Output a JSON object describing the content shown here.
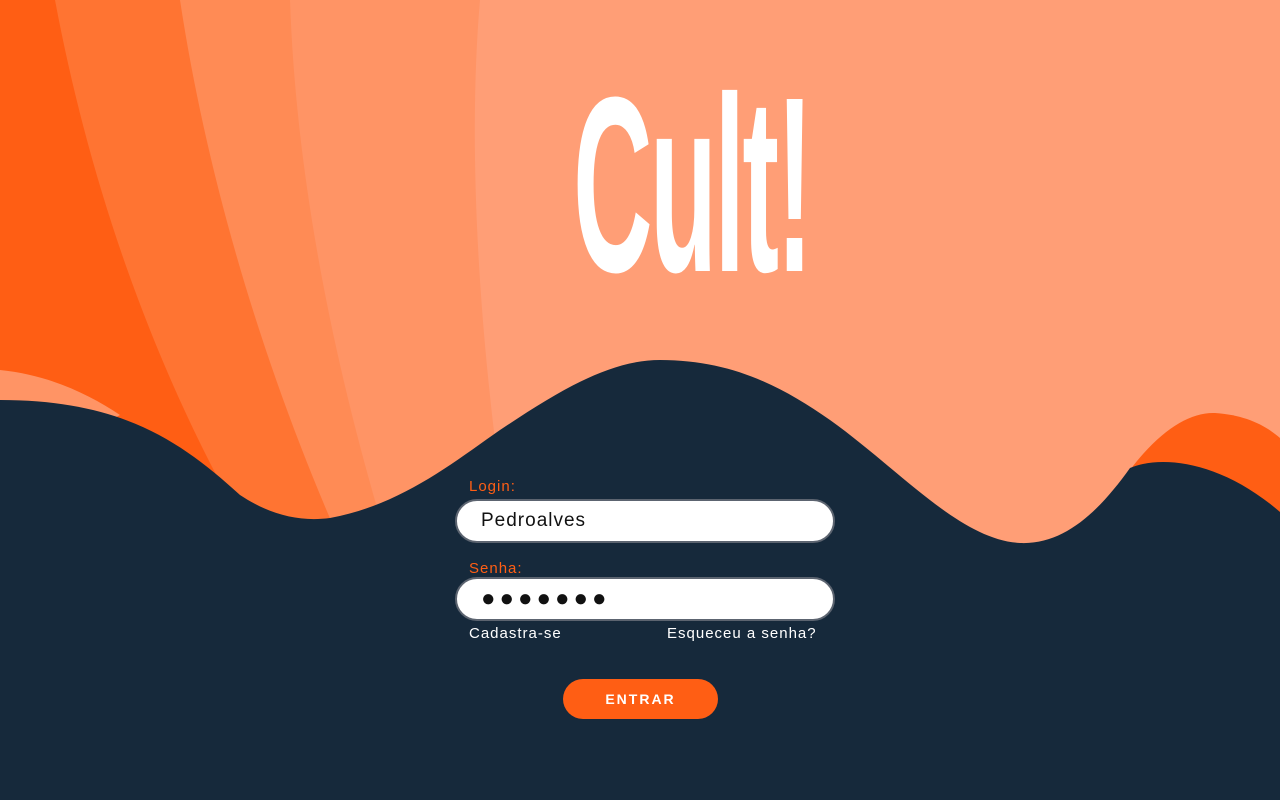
{
  "brand": {
    "logo_text": "Cult!"
  },
  "colors": {
    "accent_orange": "#ff5e14",
    "navy": "#16293b",
    "peach": "#ff9d75"
  },
  "form": {
    "login_label": "Login:",
    "login_value": "Pedroalves",
    "senha_label": "Senha:",
    "senha_value": "●●●●●●●",
    "register_link": "Cadastra-se",
    "forgot_link": "Esqueceu a senha?",
    "submit_label": "ENTRAR"
  }
}
